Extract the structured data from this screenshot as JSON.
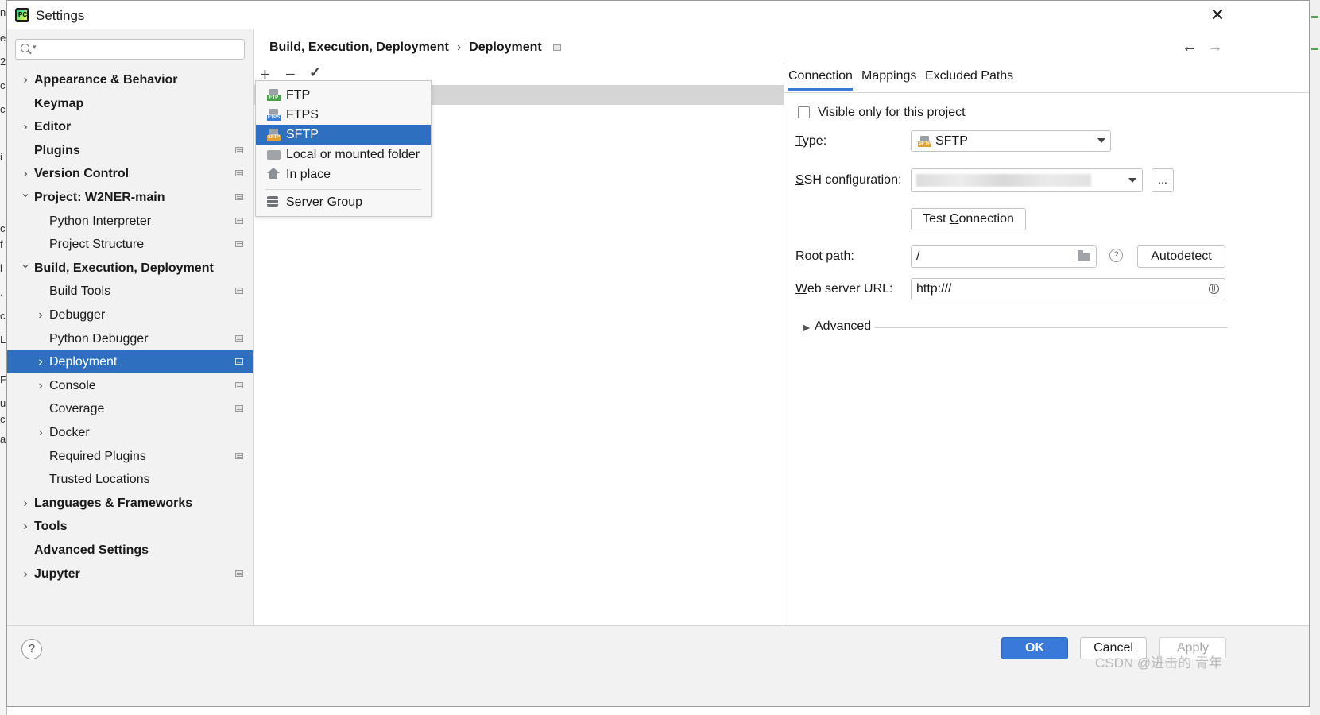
{
  "window": {
    "title": "Settings",
    "close_icon": "✕"
  },
  "search": {
    "placeholder": ""
  },
  "sidebar": {
    "items": [
      {
        "label": "Appearance & Behavior",
        "bold": true,
        "chevron": "right",
        "level": 0,
        "project_icon": false
      },
      {
        "label": "Keymap",
        "bold": true,
        "chevron": "none",
        "level": 0,
        "project_icon": false
      },
      {
        "label": "Editor",
        "bold": true,
        "chevron": "right",
        "level": 0,
        "project_icon": false
      },
      {
        "label": "Plugins",
        "bold": true,
        "chevron": "none",
        "level": 0,
        "project_icon": true
      },
      {
        "label": "Version Control",
        "bold": true,
        "chevron": "right",
        "level": 0,
        "project_icon": true
      },
      {
        "label": "Project: W2NER-main",
        "bold": true,
        "chevron": "down",
        "level": 0,
        "project_icon": true
      },
      {
        "label": "Python Interpreter",
        "bold": false,
        "chevron": "none",
        "level": 1,
        "project_icon": true
      },
      {
        "label": "Project Structure",
        "bold": false,
        "chevron": "none",
        "level": 1,
        "project_icon": true
      },
      {
        "label": "Build, Execution, Deployment",
        "bold": true,
        "chevron": "down",
        "level": 0,
        "project_icon": false
      },
      {
        "label": "Build Tools",
        "bold": false,
        "chevron": "none",
        "level": 1,
        "project_icon": true
      },
      {
        "label": "Debugger",
        "bold": false,
        "chevron": "right",
        "level": 1,
        "project_icon": false
      },
      {
        "label": "Python Debugger",
        "bold": false,
        "chevron": "none",
        "level": 1,
        "project_icon": true
      },
      {
        "label": "Deployment",
        "bold": false,
        "chevron": "right",
        "level": 1,
        "project_icon": true,
        "selected": true
      },
      {
        "label": "Console",
        "bold": false,
        "chevron": "right",
        "level": 1,
        "project_icon": true
      },
      {
        "label": "Coverage",
        "bold": false,
        "chevron": "none",
        "level": 1,
        "project_icon": true
      },
      {
        "label": "Docker",
        "bold": false,
        "chevron": "right",
        "level": 1,
        "project_icon": false
      },
      {
        "label": "Required Plugins",
        "bold": false,
        "chevron": "none",
        "level": 1,
        "project_icon": true
      },
      {
        "label": "Trusted Locations",
        "bold": false,
        "chevron": "none",
        "level": 1,
        "project_icon": false
      },
      {
        "label": "Languages & Frameworks",
        "bold": true,
        "chevron": "right",
        "level": 0,
        "project_icon": false
      },
      {
        "label": "Tools",
        "bold": true,
        "chevron": "right",
        "level": 0,
        "project_icon": false
      },
      {
        "label": "Advanced Settings",
        "bold": true,
        "chevron": "none",
        "level": 0,
        "project_icon": false
      },
      {
        "label": "Jupyter",
        "bold": true,
        "chevron": "right",
        "level": 0,
        "project_icon": true
      }
    ]
  },
  "breadcrumb": {
    "parent": "Build, Execution, Deployment",
    "separator": "›",
    "current": "Deployment"
  },
  "nav": {
    "back": "←",
    "forward": "→"
  },
  "toolbar": {
    "add": "+",
    "remove": "−",
    "check": "✓"
  },
  "add_menu": {
    "items": [
      {
        "label": "FTP",
        "icon": "ftp-icon",
        "tag": "FTP",
        "tag_color": "#4aa04a"
      },
      {
        "label": "FTPS",
        "icon": "ftps-icon",
        "tag": "FTPS",
        "tag_color": "#3a7bd5"
      },
      {
        "label": "SFTP",
        "icon": "sftp-icon",
        "tag": "SFTP",
        "tag_color": "#e0a030",
        "selected": true
      },
      {
        "label": "Local or mounted folder",
        "icon": "folder-icon",
        "tag": "",
        "tag_color": ""
      },
      {
        "label": "In place",
        "icon": "home-icon",
        "tag": "",
        "tag_color": ""
      },
      {
        "label": "Server Group",
        "icon": "server-group-icon",
        "tag": "",
        "tag_color": ""
      }
    ]
  },
  "tabs": [
    {
      "label": "Connection",
      "active": true
    },
    {
      "label": "Mappings",
      "active": false
    },
    {
      "label": "Excluded Paths",
      "active": false
    }
  ],
  "connection": {
    "visible_only_label": "Visible only for this project",
    "visible_only_checked": false,
    "type_label_pre": "",
    "type_label_u": "T",
    "type_label_post": "ype:",
    "type_value": "SFTP",
    "ssh_label_u": "S",
    "ssh_label_post": "SH configuration:",
    "ssh_more": "...",
    "test_pre": "Test ",
    "test_u": "C",
    "test_post": "onnection",
    "root_label_u": "R",
    "root_label_post": "oot path:",
    "root_value": "/",
    "help_glyph": "?",
    "autodetect": "Autodetect",
    "web_label_u": "W",
    "web_label_post": "eb server URL:",
    "web_value": "http:///",
    "advanced_label": "Advanced",
    "advanced_chevron": "▶"
  },
  "footer": {
    "help": "?",
    "ok": "OK",
    "cancel": "Cancel",
    "apply": "Apply"
  },
  "watermark": "CSDN @进击的 青年",
  "colors": {
    "accent": "#2f6fc0",
    "ok": "#3879d9",
    "sidebar_bg": "#f2f2f2"
  }
}
